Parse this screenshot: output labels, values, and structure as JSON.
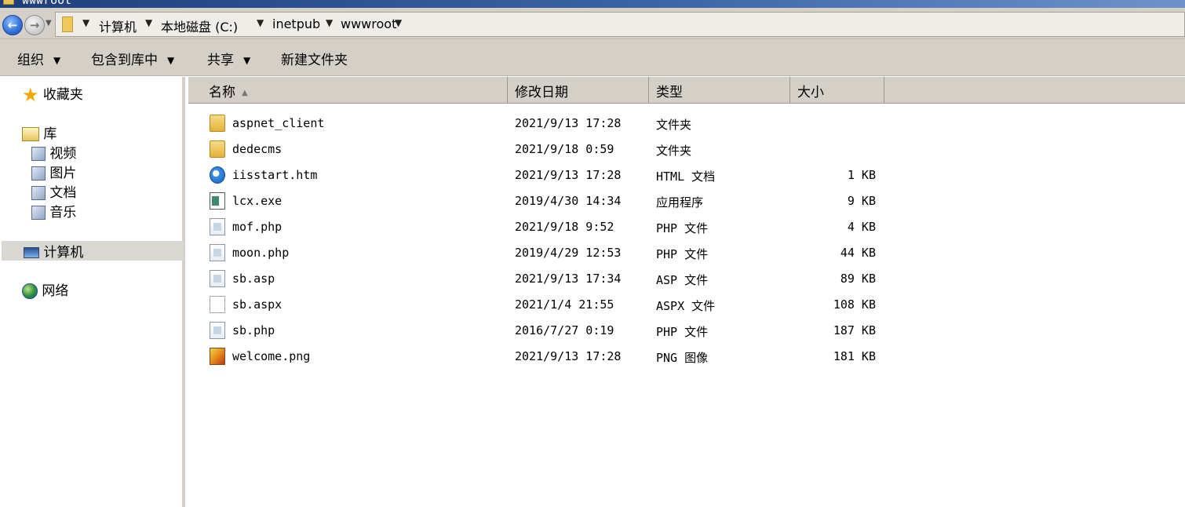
{
  "window": {
    "title": "wwwroot"
  },
  "addressbar": {
    "breadcrumbs": [
      "计算机",
      "本地磁盘 (C:)",
      "inetpub",
      "wwwroot"
    ]
  },
  "toolbar": {
    "organize": "组织",
    "include_in_library": "包含到库中",
    "share": "共享",
    "new_folder": "新建文件夹"
  },
  "nav": {
    "favorites": "收藏夹",
    "libraries": "库",
    "videos": "视频",
    "pictures": "图片",
    "documents": "文档",
    "music": "音乐",
    "computer": "计算机",
    "network": "网络"
  },
  "columns": {
    "name": "名称",
    "date": "修改日期",
    "type": "类型",
    "size": "大小"
  },
  "files": [
    {
      "name": "aspnet_client",
      "date": "2021/9/13 17:28",
      "type": "文件夹",
      "size": "",
      "icon": "folder-icon"
    },
    {
      "name": "dedecms",
      "date": "2021/9/18 0:59",
      "type": "文件夹",
      "size": "",
      "icon": "folder-icon"
    },
    {
      "name": "iisstart.htm",
      "date": "2021/9/13 17:28",
      "type": "HTML 文档",
      "size": "1 KB",
      "icon": "ie-icon"
    },
    {
      "name": "lcx.exe",
      "date": "2019/4/30 14:34",
      "type": "应用程序",
      "size": "9 KB",
      "icon": "exe-icon"
    },
    {
      "name": "mof.php",
      "date": "2021/9/18 9:52",
      "type": "PHP 文件",
      "size": "4 KB",
      "icon": "doc-icon"
    },
    {
      "name": "moon.php",
      "date": "2019/4/29 12:53",
      "type": "PHP 文件",
      "size": "44 KB",
      "icon": "doc-icon"
    },
    {
      "name": "sb.asp",
      "date": "2021/9/13 17:34",
      "type": "ASP 文件",
      "size": "89 KB",
      "icon": "doc-icon"
    },
    {
      "name": "sb.aspx",
      "date": "2021/1/4 21:55",
      "type": "ASPX 文件",
      "size": "108 KB",
      "icon": "blank-file-icon"
    },
    {
      "name": "sb.php",
      "date": "2016/7/27 0:19",
      "type": "PHP 文件",
      "size": "187 KB",
      "icon": "doc-icon"
    },
    {
      "name": "welcome.png",
      "date": "2021/9/13 17:28",
      "type": "PNG 图像",
      "size": "181 KB",
      "icon": "image-icon"
    }
  ]
}
